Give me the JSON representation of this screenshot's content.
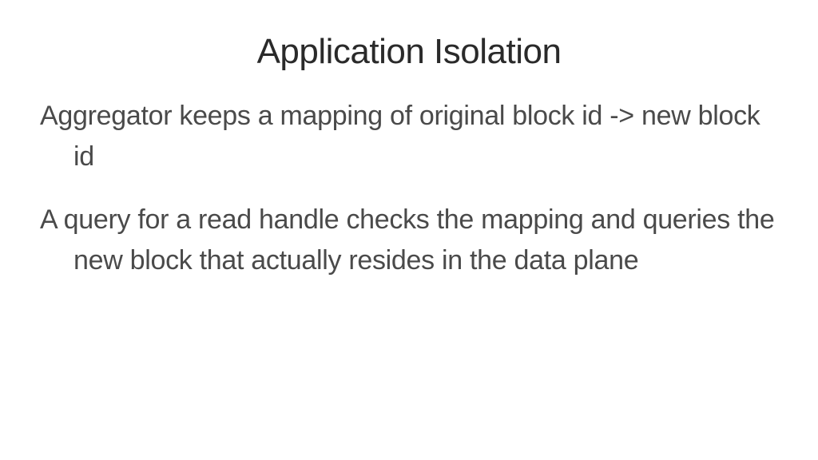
{
  "slide": {
    "title": "Application Isolation",
    "paragraphs": [
      "Aggregator keeps a mapping of original block id -> new block id",
      "A query for a read handle checks the mapping and queries the new block that actually resides in the data plane"
    ]
  }
}
